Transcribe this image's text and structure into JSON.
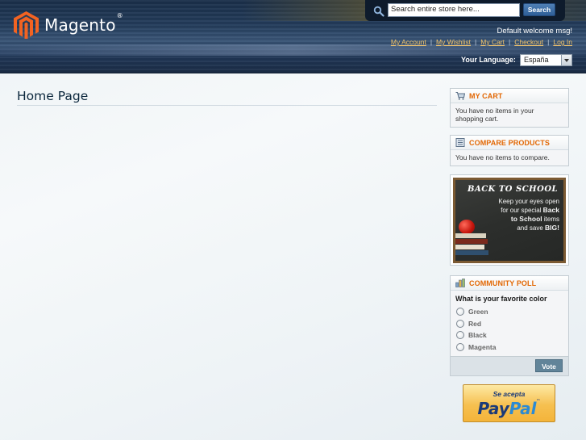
{
  "header": {
    "logo_text": "Magento",
    "logo_reg": "®",
    "search": {
      "placeholder": "Search entire store here...",
      "value": "Search entire store here...",
      "button_label": "Search"
    },
    "welcome": "Default welcome msg!",
    "links": [
      {
        "label": "My Account"
      },
      {
        "label": "My Wishlist"
      },
      {
        "label": "My Cart"
      },
      {
        "label": "Checkout"
      },
      {
        "label": "Log In"
      }
    ],
    "separator": "|",
    "language_label": "Your Language:",
    "language_value": "España"
  },
  "main": {
    "title": "Home Page"
  },
  "sidebar": {
    "cart": {
      "title": "MY CART",
      "text": "You have no items in your shopping cart."
    },
    "compare": {
      "title": "COMPARE PRODUCTS",
      "text": "You have no items to compare."
    },
    "banner": {
      "title": "BACK TO SCHOOL",
      "line1": "Keep your eyes open",
      "line2": "for our special",
      "line2_bold": "Back",
      "line3_bold": "to School",
      "line3": "items",
      "line4": "and save",
      "line4_bold": "BIG!"
    },
    "poll": {
      "title": "COMMUNITY POLL",
      "question": "What is your favorite color",
      "options": [
        "Green",
        "Red",
        "Black",
        "Magenta"
      ],
      "vote_label": "Vote"
    },
    "paypal": {
      "caption": "Se acepta",
      "brand_1": "Pay",
      "brand_2": "Pal",
      "tm": "™"
    }
  },
  "colors": {
    "accent_orange": "#e26703",
    "link_gold": "#f3c46b",
    "header_navy": "#1b2d47",
    "title_blue": "#0a263c"
  }
}
